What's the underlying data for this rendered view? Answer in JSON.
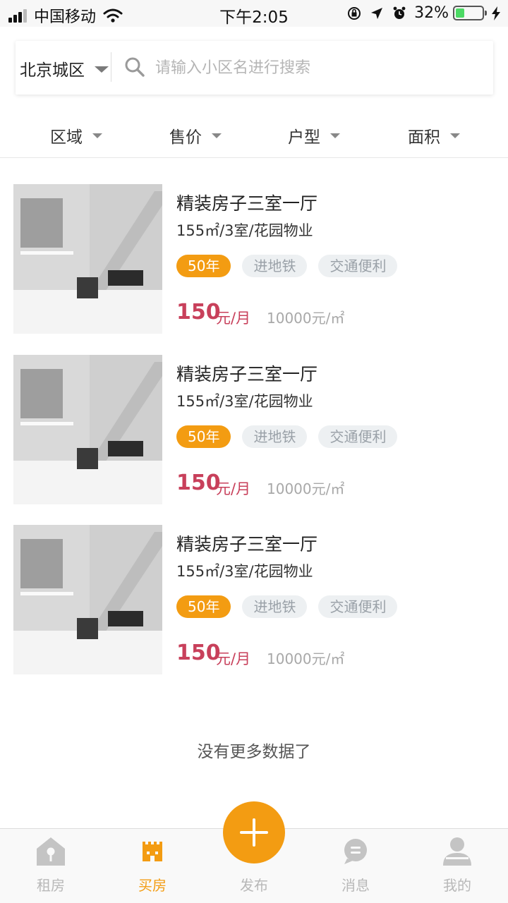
{
  "status_bar": {
    "carrier": "中国移动",
    "time": "下午2:05",
    "battery_percent_label": "32%",
    "battery_level": 0.32
  },
  "search": {
    "city": "北京城区",
    "placeholder": "请输入小区名进行搜索",
    "value": ""
  },
  "filters": [
    {
      "label": "区域"
    },
    {
      "label": "售价"
    },
    {
      "label": "户型"
    },
    {
      "label": "面积"
    }
  ],
  "listings": [
    {
      "title": "精装房子三室一厅",
      "spec": "155㎡/3室/花园物业",
      "tags": [
        "50年",
        "进地铁",
        "交通便利"
      ],
      "price": "150",
      "price_unit": "元/月",
      "unit_price": "10000元/㎡"
    },
    {
      "title": "精装房子三室一厅",
      "spec": "155㎡/3室/花园物业",
      "tags": [
        "50年",
        "进地铁",
        "交通便利"
      ],
      "price": "150",
      "price_unit": "元/月",
      "unit_price": "10000元/㎡"
    },
    {
      "title": "精装房子三室一厅",
      "spec": "155㎡/3室/花园物业",
      "tags": [
        "50年",
        "进地铁",
        "交通便利"
      ],
      "price": "150",
      "price_unit": "元/月",
      "unit_price": "10000元/㎡"
    }
  ],
  "no_more_text": "没有更多数据了",
  "tab_bar": {
    "tabs": [
      {
        "label": "租房",
        "icon": "house-key-icon",
        "active": false
      },
      {
        "label": "买房",
        "icon": "building-icon",
        "active": true
      },
      {
        "label": "发布",
        "icon": "plus-icon",
        "active": false
      },
      {
        "label": "消息",
        "icon": "chat-bubble-icon",
        "active": false
      },
      {
        "label": "我的",
        "icon": "user-icon",
        "active": false
      }
    ]
  },
  "colors": {
    "accent": "#f39c12",
    "price": "#c8405b",
    "tag_gray_bg": "#edf0f2",
    "tab_inactive": "#b8b8b8"
  }
}
